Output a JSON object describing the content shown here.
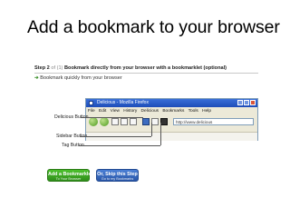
{
  "slide": {
    "title": "Add a bookmark to your browser"
  },
  "step": {
    "prefix": "Step 2",
    "of": "of (1)",
    "text": "Bookmark directly from your browser with a bookmarklet (optional)"
  },
  "quick": {
    "arrow": "➔",
    "text": "Bookmark quickly from your browser"
  },
  "browser": {
    "title": "Delicious - Mozilla Firefox",
    "menu": "File Edit View History Delicious Bookmarks Tools Help",
    "url": "http://www.delicious"
  },
  "callouts": {
    "delicious": "Delicious Button",
    "sidebar": "Sidebar Button",
    "tag": "Tag Button"
  },
  "buttons": {
    "add": {
      "label": "Add a Bookmarklet",
      "sub": "To Your Browser"
    },
    "skip": {
      "label": "Or, Skip this Step",
      "sub": "Go to my Bookmarks"
    }
  },
  "colors": {
    "add_button": "#3aa82a",
    "skip_button": "#3565bf",
    "titlebar": "#2a5ccc"
  }
}
